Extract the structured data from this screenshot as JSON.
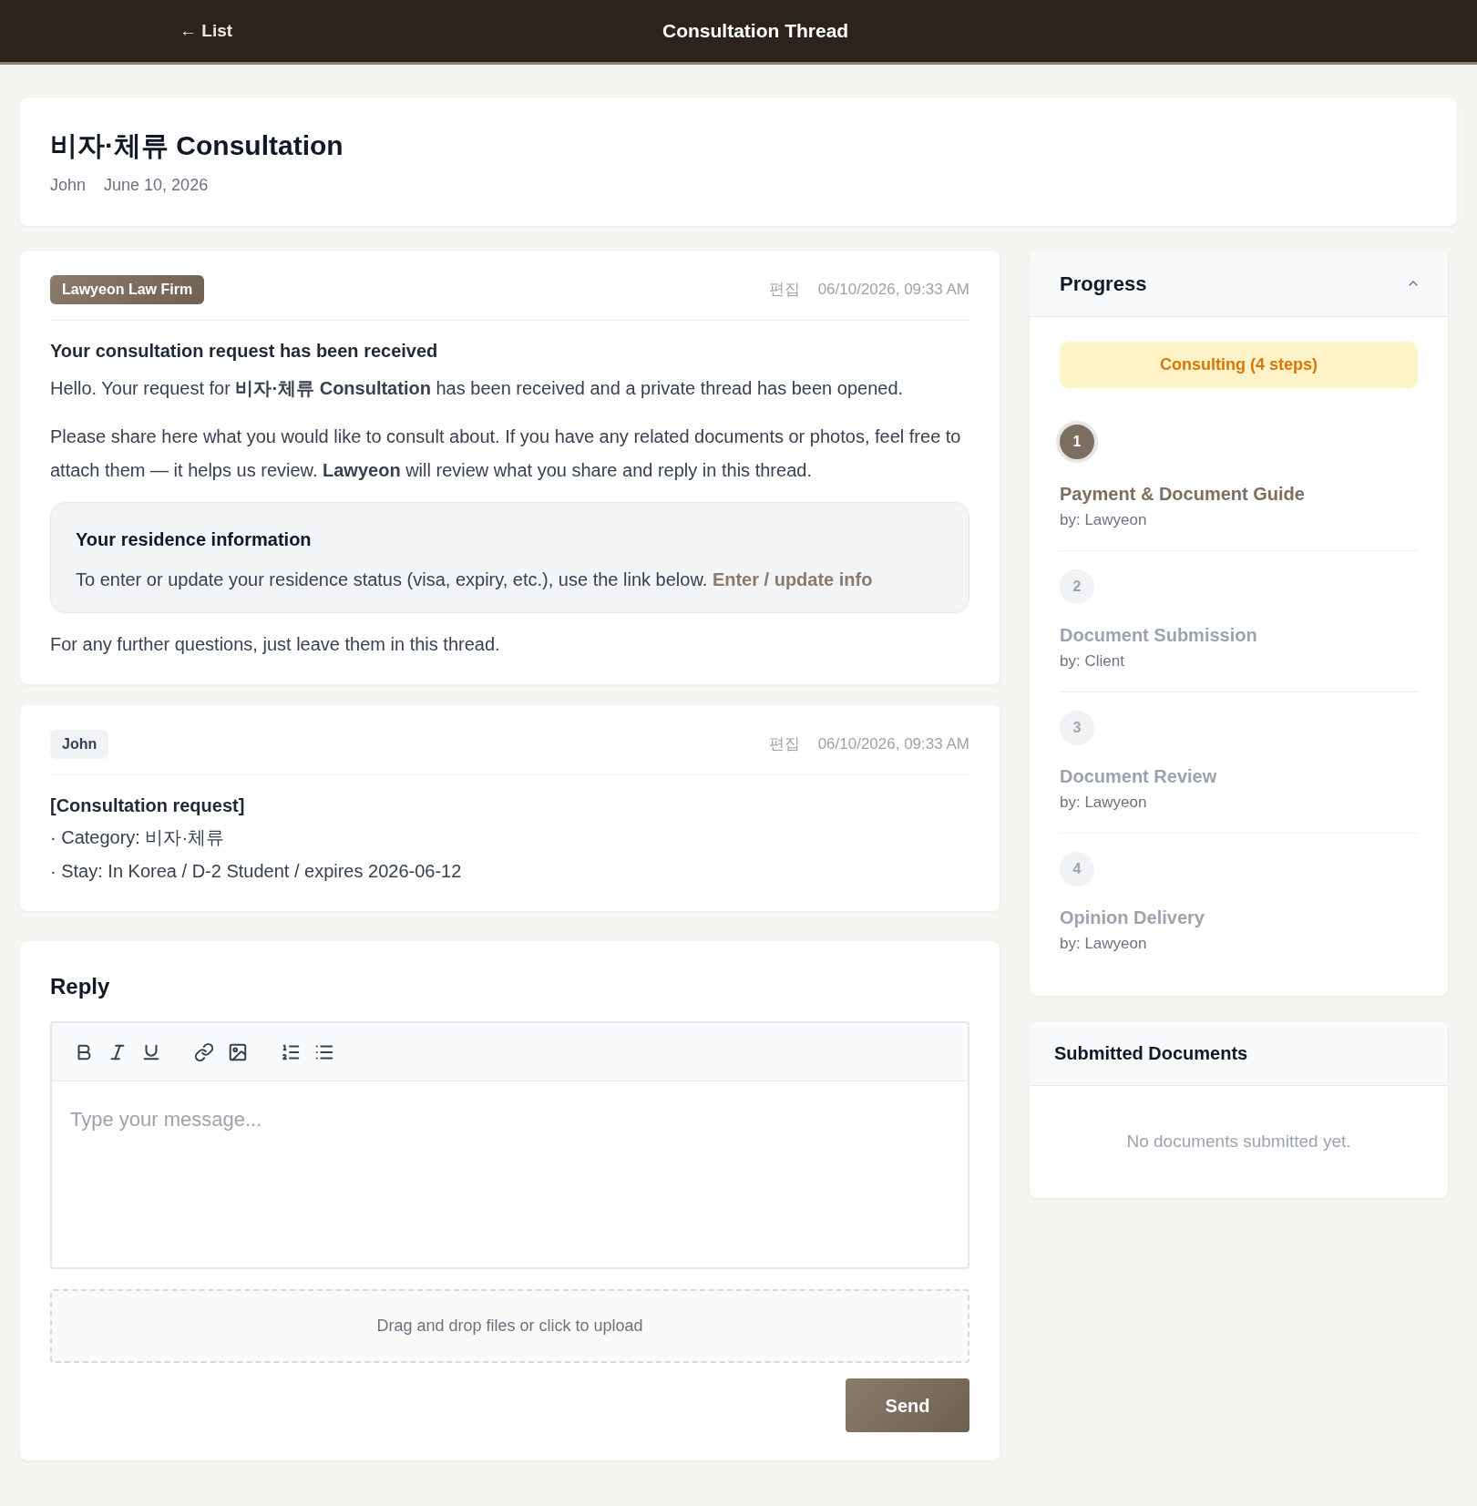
{
  "header": {
    "back_link": "← List",
    "title": "Consultation Thread"
  },
  "thread": {
    "title": "비자·체류 Consultation",
    "author": "John",
    "date": "June 10, 2026"
  },
  "messages": [
    {
      "kind": "firm",
      "sender": "Lawyeon Law Firm",
      "edit": "편집",
      "timestamp": "06/10/2026, 09:33 AM",
      "blocks": [
        {
          "kind": "heading",
          "text": "Your consultation request has been received"
        },
        {
          "kind": "paragraph",
          "text": "Hello. Your request for **비자·체류 Consultation** has been received and a private thread has been opened."
        },
        {
          "kind": "paragraph",
          "text": "Please share here what you would like to consult about. If you have any related documents or photos, feel free to attach them — it helps us review. **Lawyeon** will review what you share and reply in this thread."
        },
        {
          "kind": "info_box",
          "title": "Your residence information",
          "text": "To enter or update your residence status (visa, expiry, etc.), use the link below.",
          "link": "Enter / update info"
        },
        {
          "kind": "paragraph",
          "text": "For any further questions, just leave them in this thread."
        }
      ]
    },
    {
      "kind": "client",
      "sender": "John",
      "edit": "편집",
      "timestamp": "06/10/2026, 09:33 AM",
      "blocks": [
        {
          "kind": "heading",
          "text": "[Consultation request]"
        },
        {
          "kind": "line",
          "text": "· Category: 비자·체류"
        },
        {
          "kind": "line",
          "text": "· Stay: In Korea / D-2 Student / expires 2026-06-12"
        }
      ]
    }
  ],
  "reply": {
    "title": "Reply",
    "placeholder": "Type your message...",
    "upload": "Drag and drop files or click to upload",
    "send": "Send"
  },
  "progress": {
    "title": "Progress",
    "expanded": true,
    "status": "Consulting (4 steps)",
    "steps": [
      {
        "number": "1",
        "title": "Payment & Document Guide",
        "by": "by: Lawyeon",
        "active": true
      },
      {
        "number": "2",
        "title": "Document Submission",
        "by": "by: Client",
        "active": false
      },
      {
        "number": "3",
        "title": "Document Review",
        "by": "by: Lawyeon",
        "active": false
      },
      {
        "number": "4",
        "title": "Opinion Delivery",
        "by": "by: Lawyeon",
        "active": false
      }
    ]
  },
  "documents": {
    "title": "Submitted Documents",
    "empty_text": "No documents submitted yet."
  }
}
